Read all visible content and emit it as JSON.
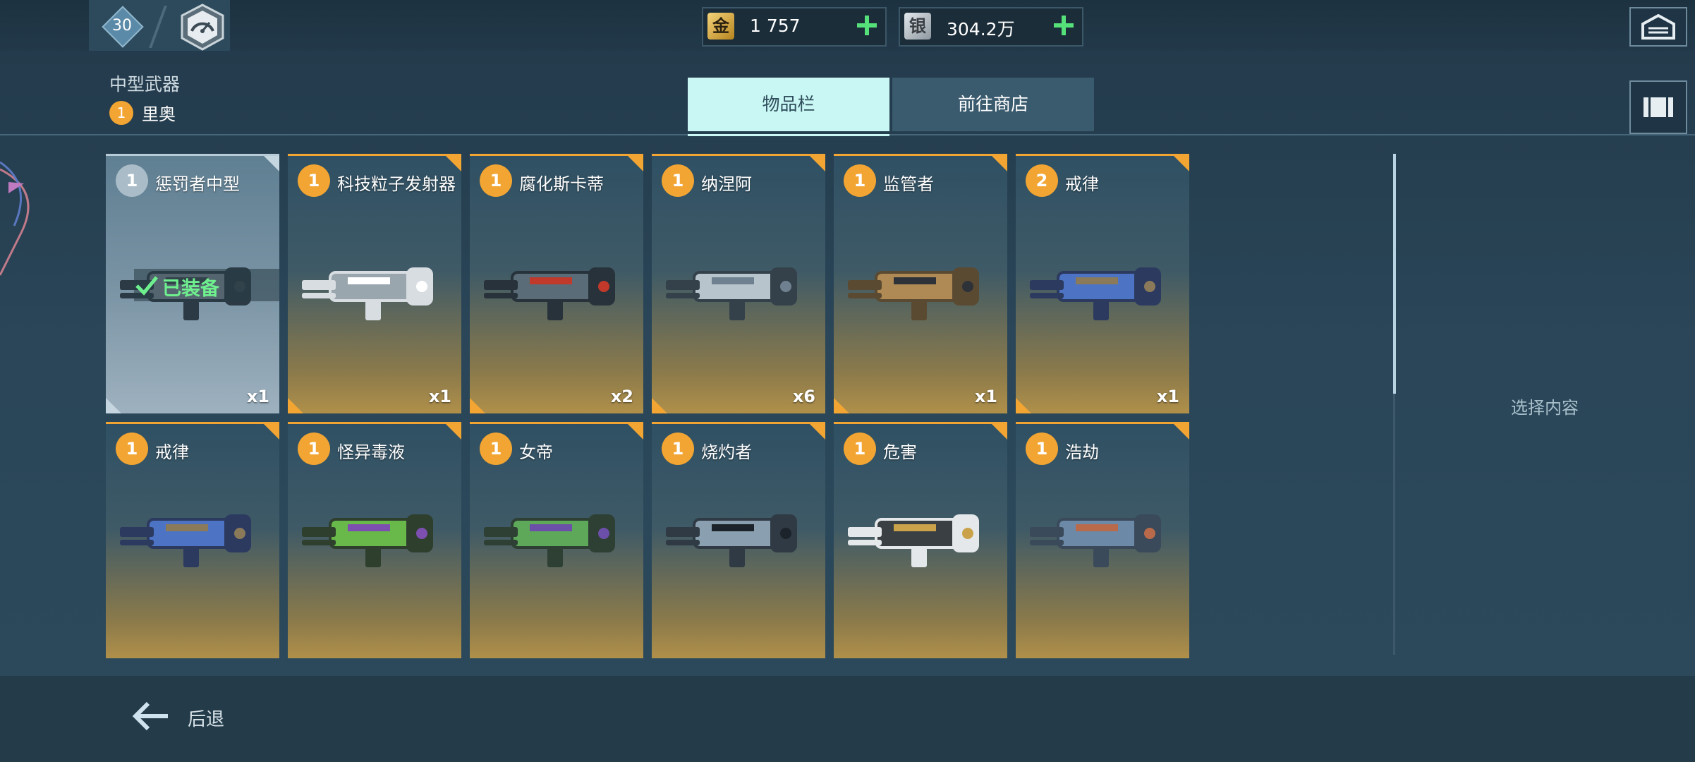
{
  "player": {
    "level": "30",
    "rank_icon": "speedometer-icon"
  },
  "currency": {
    "gold": {
      "icon_label": "金",
      "value": "1 757"
    },
    "silver": {
      "icon_label": "银",
      "value": "304.2万"
    }
  },
  "header": {
    "category": "中型武器",
    "sub_rank": "1",
    "sub_name": "里奥"
  },
  "tabs": {
    "inventory": "物品栏",
    "shop": "前往商店"
  },
  "equipped_label": "已装备",
  "items": [
    {
      "rank": "1",
      "name": "惩罚者中型",
      "qty": "x1",
      "equipped": true
    },
    {
      "rank": "1",
      "name": "科技粒子发射器",
      "qty": "x1"
    },
    {
      "rank": "1",
      "name": "腐化斯卡蒂",
      "qty": "x2"
    },
    {
      "rank": "1",
      "name": "纳涅阿",
      "qty": "x6"
    },
    {
      "rank": "1",
      "name": "监管者",
      "qty": "x1"
    },
    {
      "rank": "2",
      "name": "戒律",
      "qty": "x1"
    },
    {
      "rank": "1",
      "name": "戒律",
      "qty": ""
    },
    {
      "rank": "1",
      "name": "怪异毒液",
      "qty": ""
    },
    {
      "rank": "1",
      "name": "女帝",
      "qty": ""
    },
    {
      "rank": "1",
      "name": "烧灼者",
      "qty": ""
    },
    {
      "rank": "1",
      "name": "危害",
      "qty": ""
    },
    {
      "rank": "1",
      "name": "浩劫",
      "qty": ""
    }
  ],
  "right_panel": {
    "placeholder": "选择内容"
  },
  "footer": {
    "back_label": "后退"
  },
  "colors": {
    "accent_orange": "#f2a532",
    "equipped_green": "#6ff08e",
    "plus_green": "#55e07a",
    "tab_active": "#c9f7f4"
  }
}
